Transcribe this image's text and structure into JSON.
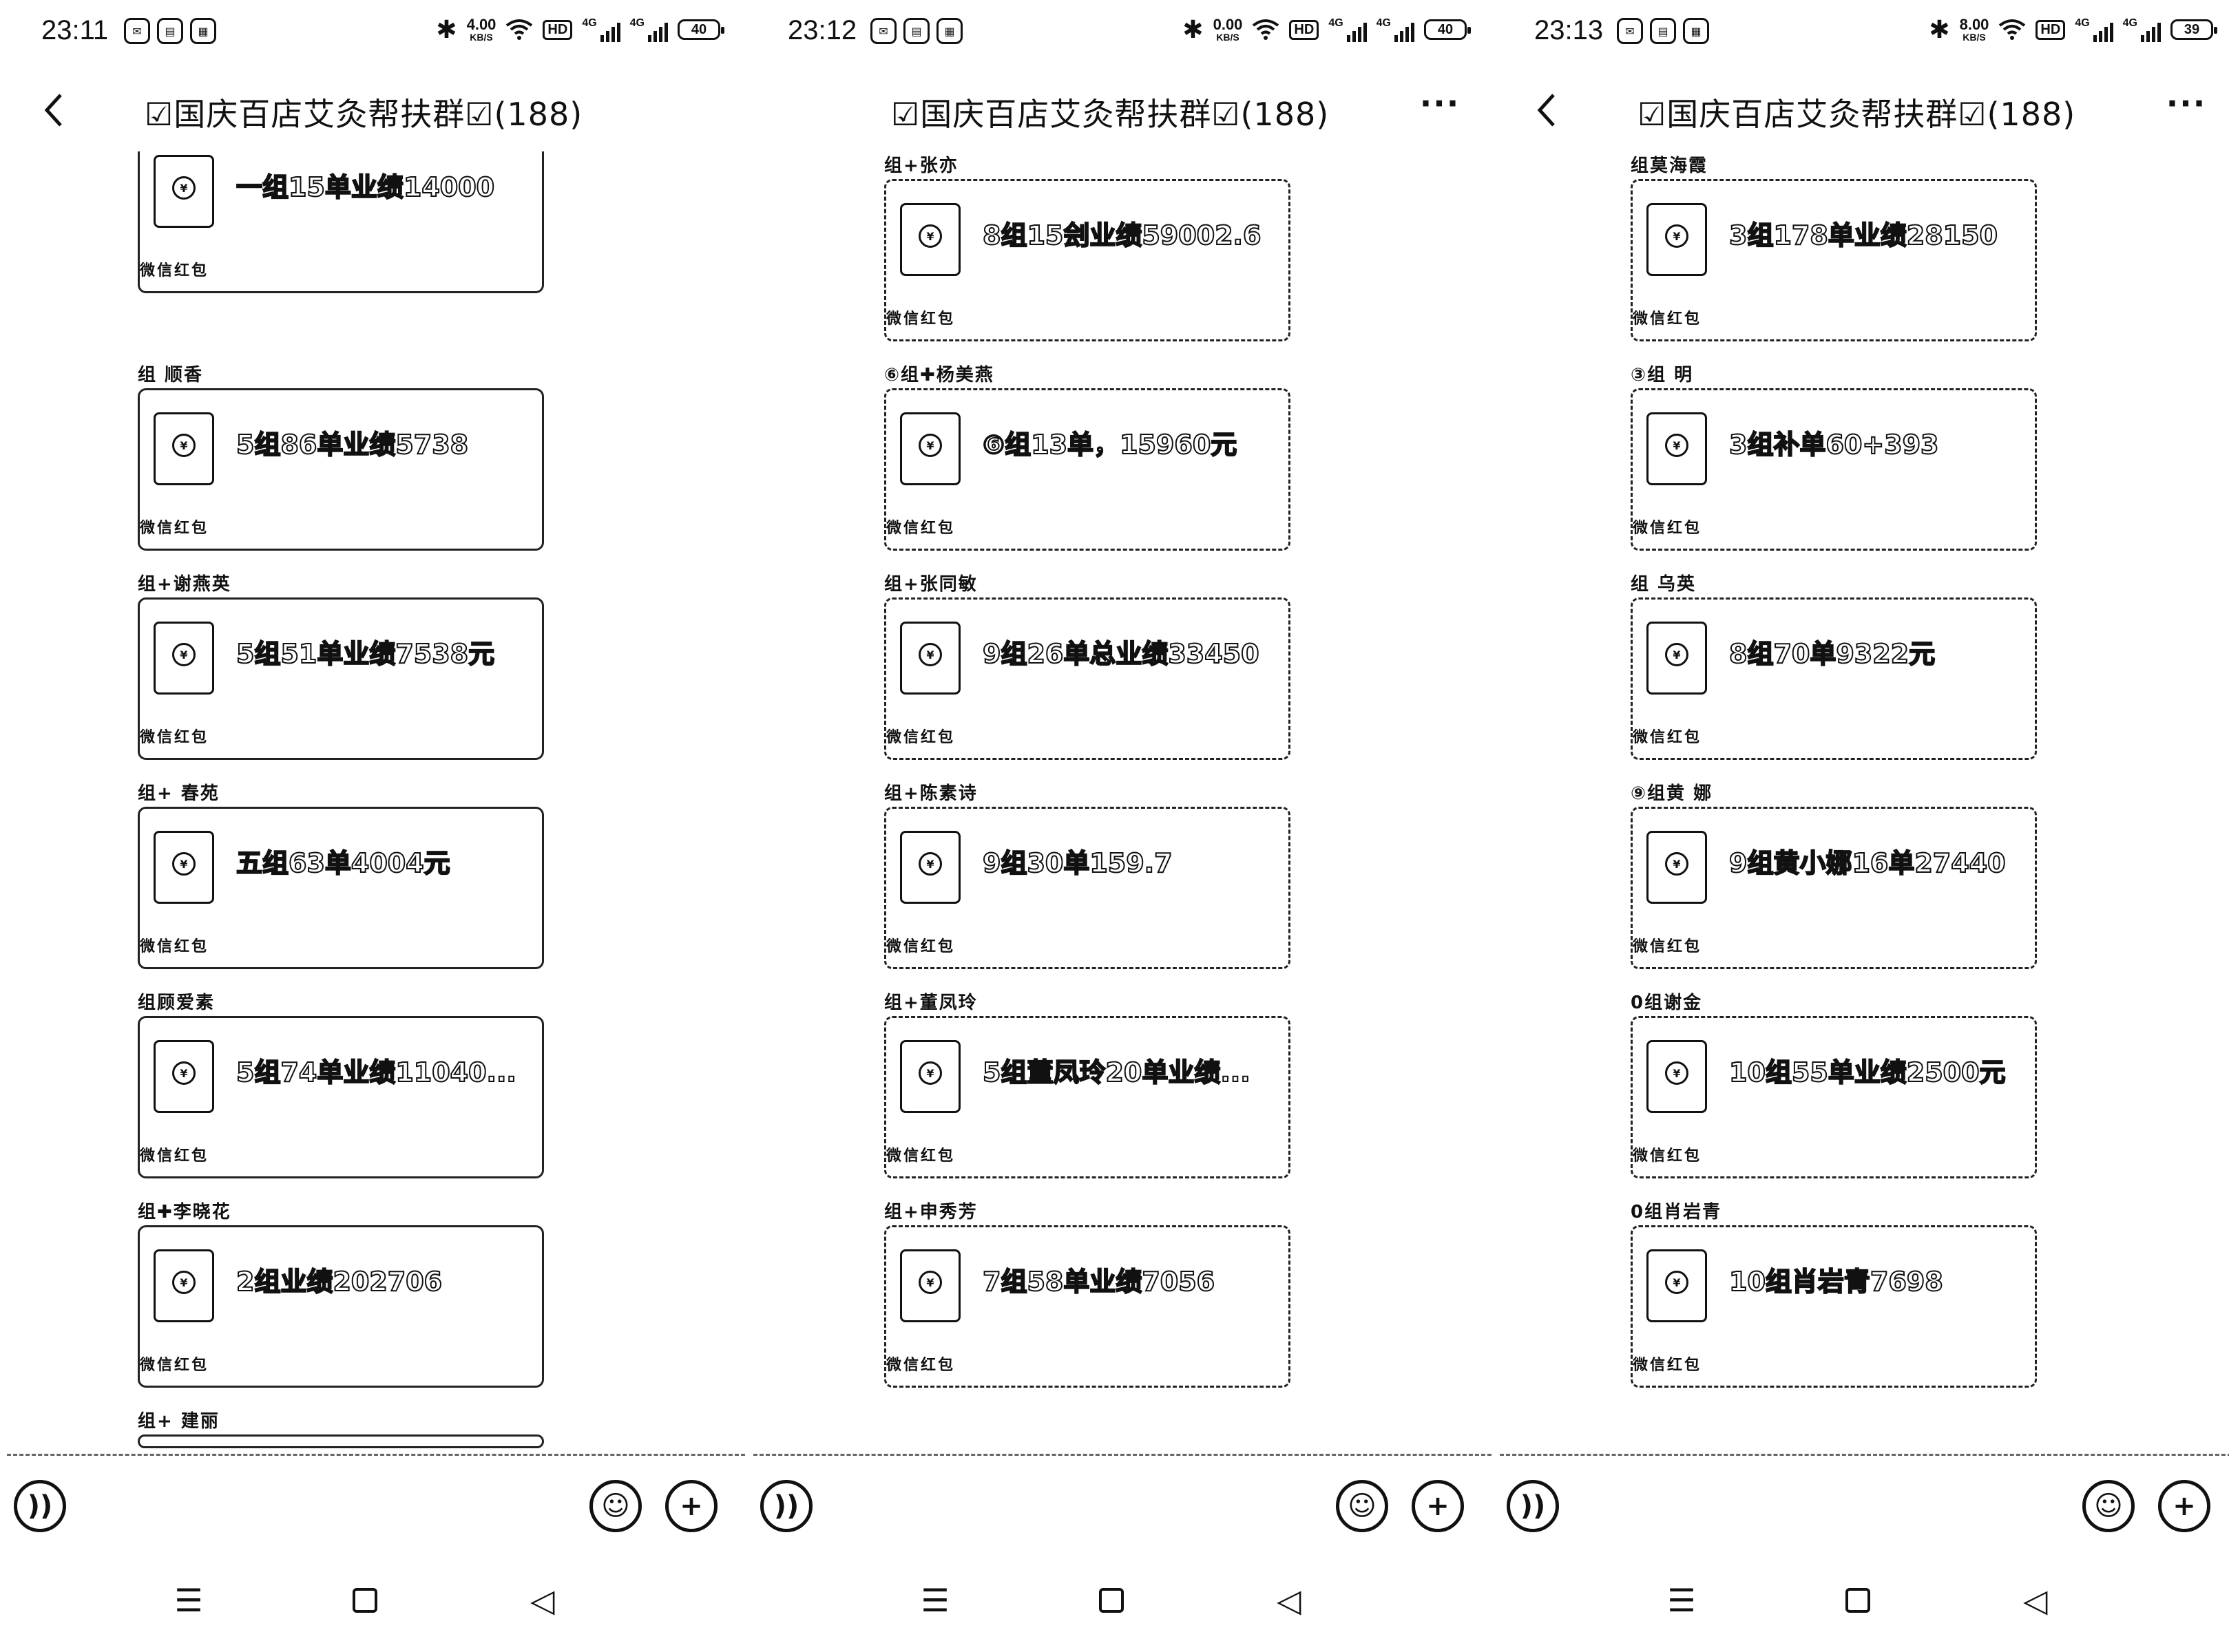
{
  "screens": [
    {
      "status": {
        "time": "23:11",
        "speed_value": "4.00",
        "speed_unit": "KB/S",
        "hd": "HD",
        "net1": "4G",
        "net2": "4G",
        "battery": "40"
      },
      "header": {
        "title": "☑国庆百店艾灸帮扶群☑(188)",
        "back_icon": "back-icon",
        "more": ""
      },
      "messages": [
        {
          "sender": "",
          "text": "一组15单业绩14000",
          "foot": "微信红包"
        },
        {
          "sender": "组 顺香",
          "text": "5组86单业绩5738",
          "foot": "微信红包"
        },
        {
          "sender": "组+谢燕英",
          "text": "5组51单业绩7538元",
          "foot": "微信红包"
        },
        {
          "sender": "组+ 春苑",
          "text": "五组63单4004元",
          "foot": "微信红包"
        },
        {
          "sender": "组顾爱素",
          "text": "5组74单业绩11040...",
          "foot": "微信红包"
        },
        {
          "sender": "组✚李晓花",
          "text": "2组业绩202706",
          "foot": "微信红包"
        },
        {
          "sender": "组+ 建丽",
          "text": "",
          "foot": ""
        }
      ]
    },
    {
      "status": {
        "time": "23:12",
        "speed_value": "0.00",
        "speed_unit": "KB/S",
        "hd": "HD",
        "net1": "4G",
        "net2": "4G",
        "battery": "40"
      },
      "header": {
        "title": "☑国庆百店艾灸帮扶群☑(188)",
        "back_icon": "",
        "more": "···"
      },
      "messages": [
        {
          "sender": "组+张亦",
          "text": "8组15刽业绩59002.6",
          "foot": "微信红包"
        },
        {
          "sender": "⑥组✚杨美燕",
          "text": "⑥组13单，15960元",
          "foot": "微信红包"
        },
        {
          "sender": "组+张同敏",
          "text": "9组26单总业绩33450",
          "foot": "微信红包"
        },
        {
          "sender": "组+陈素诗",
          "text": "9组30单159.7",
          "foot": "微信红包"
        },
        {
          "sender": "组+董凤玲",
          "text": "5组董凤玲20单业绩...",
          "foot": "微信红包"
        },
        {
          "sender": "组+申秀芳",
          "text": "7组58单业绩7056",
          "foot": "微信红包"
        }
      ]
    },
    {
      "status": {
        "time": "23:13",
        "speed_value": "8.00",
        "speed_unit": "KB/S",
        "hd": "HD",
        "net1": "4G",
        "net2": "4G",
        "battery": "39"
      },
      "header": {
        "title": "☑国庆百店艾灸帮扶群☑(188)",
        "back_icon": "back-icon",
        "more": "···"
      },
      "messages": [
        {
          "sender": "组莫海霞",
          "text": "3组178单业绩28150",
          "foot": "微信红包"
        },
        {
          "sender": "③组 明 ",
          "text": "3组补单60+393",
          "foot": "微信红包"
        },
        {
          "sender": "组 乌英",
          "text": "8组70单9322元",
          "foot": "微信红包"
        },
        {
          "sender": "⑨组黄 娜",
          "text": "9组黄小娜16单27440",
          "foot": "微信红包"
        },
        {
          "sender": "0组谢金 ",
          "text": "10组55单业绩2500元",
          "foot": "微信红包"
        },
        {
          "sender": "0组肖岩青",
          "text": "10组肖岩青7698",
          "foot": "微信红包"
        }
      ]
    }
  ],
  "footer": {
    "voice_icon": "voice-icon",
    "emoji_icon": "emoji-icon",
    "plus_icon": "plus-icon"
  },
  "navbar": {
    "menu_glyph": "☰",
    "back_glyph": "◁"
  }
}
